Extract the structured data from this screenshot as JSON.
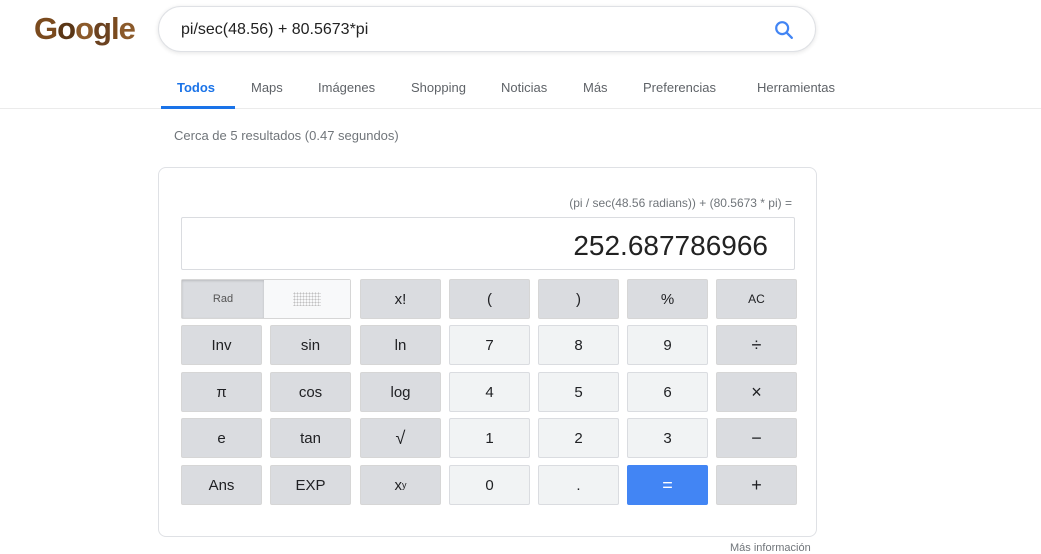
{
  "logo": {
    "text": "Google"
  },
  "search": {
    "query": "pi/sec(48.56) + 80.5673*pi"
  },
  "tabs": [
    "Todos",
    "Maps",
    "Imágenes",
    "Shopping",
    "Noticias",
    "Más",
    "Preferencias",
    "Herramientas"
  ],
  "active_tab": "Todos",
  "result_stats": "Cerca de 5 resultados (0.47 segundos)",
  "calculator": {
    "expression": "(pi / sec(48.56 radians)) + (80.5673 * pi) =",
    "result": "252.687786966",
    "mode": "Rad",
    "keys": {
      "fact": "x!",
      "lparen": "(",
      "rparen": ")",
      "percent": "%",
      "ac": "AC",
      "inv": "Inv",
      "sin": "sin",
      "ln": "ln",
      "seven": "7",
      "eight": "8",
      "nine": "9",
      "divide": "÷",
      "pi": "π",
      "cos": "cos",
      "log": "log",
      "four": "4",
      "five": "5",
      "six": "6",
      "multiply": "×",
      "e": "e",
      "tan": "tan",
      "sqrt": "√",
      "one": "1",
      "two": "2",
      "three": "3",
      "minus": "−",
      "ans": "Ans",
      "exp": "EXP",
      "pow_base": "x",
      "pow_exp": "y",
      "zero": "0",
      "dot": ".",
      "equals": "=",
      "plus": "+"
    },
    "colors": {
      "equals": "#4285f4",
      "function_key": "#dadce0",
      "number_key": "#f1f3f4"
    }
  },
  "more_info": "Más información"
}
